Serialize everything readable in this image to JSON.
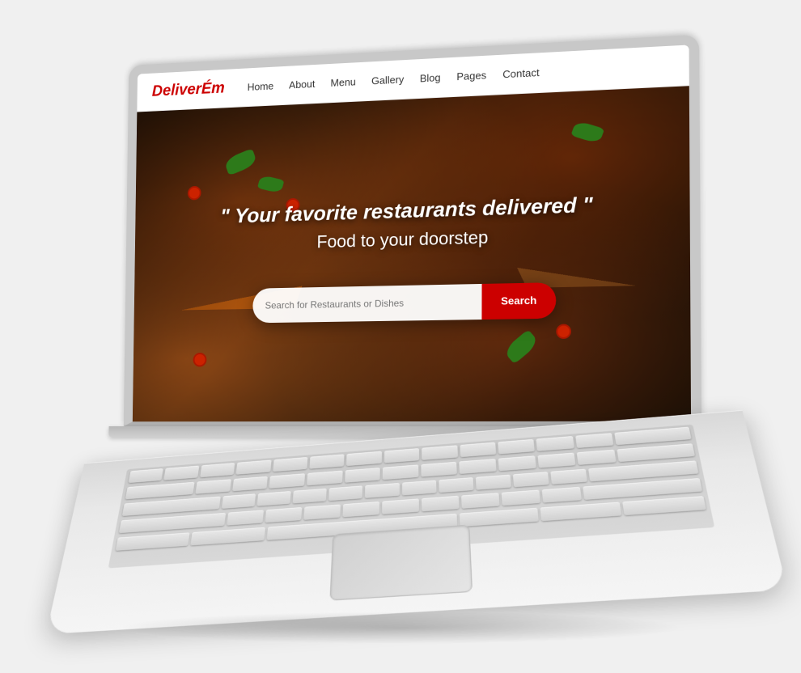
{
  "brand": {
    "logo": "DeliverÉm"
  },
  "nav": {
    "links": [
      {
        "label": "Home",
        "id": "home"
      },
      {
        "label": "About",
        "id": "about"
      },
      {
        "label": "Menu",
        "id": "menu"
      },
      {
        "label": "Gallery",
        "id": "gallery"
      },
      {
        "label": "Blog",
        "id": "blog"
      },
      {
        "label": "Pages",
        "id": "pages"
      },
      {
        "label": "Contact",
        "id": "contact"
      }
    ]
  },
  "hero": {
    "title": "\" Your favorite restaurants delivered \"",
    "subtitle": "Food to your doorstep"
  },
  "search": {
    "placeholder": "Search for Restaurants or Dishes",
    "button_label": "Search"
  },
  "colors": {
    "brand_red": "#cc0000",
    "search_button_bg": "#cc0000"
  }
}
